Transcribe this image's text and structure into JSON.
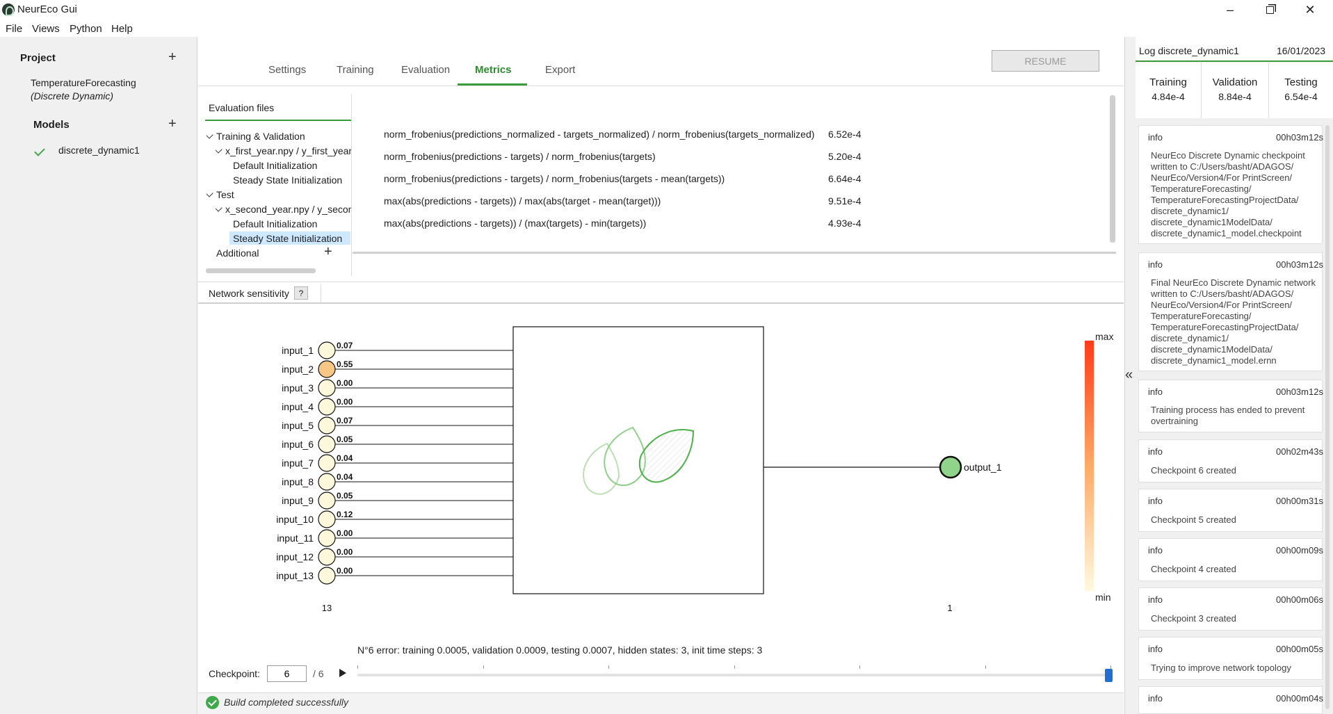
{
  "window": {
    "title": "NeurEco Gui"
  },
  "menu": [
    "File",
    "Views",
    "Python",
    "Help"
  ],
  "project": {
    "section_label": "Project",
    "name": "TemperatureForecasting",
    "type": "(Discrete Dynamic)",
    "models_label": "Models",
    "models": [
      "discrete_dynamic1"
    ]
  },
  "tabs": [
    "Settings",
    "Training",
    "Evaluation",
    "Metrics",
    "Export"
  ],
  "active_tab": "Metrics",
  "resume_label": "RESUME",
  "evaluation": {
    "header": "Evaluation files",
    "tree": {
      "group1": "Training & Validation",
      "file1": "x_first_year.npy / y_first_year.",
      "init_default1": "Default Initialization",
      "init_steady1": "Steady State Initialization",
      "group2": "Test",
      "file2": "x_second_year.npy / y_second",
      "init_default2": "Default Initialization",
      "init_steady2": "Steady State Initialization",
      "additional": "Additional"
    }
  },
  "metrics": [
    {
      "label": "norm_frobenius(predictions_normalized - targets_normalized) / norm_frobenius(targets_normalized)",
      "value": "6.52e-4"
    },
    {
      "label": "norm_frobenius(predictions - targets) / norm_frobenius(targets)",
      "value": "5.20e-4"
    },
    {
      "label": "norm_frobenius(predictions - targets) / norm_frobenius(targets - mean(targets))",
      "value": "6.64e-4"
    },
    {
      "label": "max(abs(predictions - targets)) / max(abs(target - mean(target)))",
      "value": "9.51e-4"
    },
    {
      "label": "max(abs(predictions - targets)) / (max(targets) - min(targets))",
      "value": "4.93e-4"
    }
  ],
  "sensitivity": {
    "tab_label": "Network sensitivity",
    "help_label": "?",
    "inputs": [
      {
        "name": "input_1",
        "value": "0.07"
      },
      {
        "name": "input_2",
        "value": "0.55"
      },
      {
        "name": "input_3",
        "value": "0.00"
      },
      {
        "name": "input_4",
        "value": "0.00"
      },
      {
        "name": "input_5",
        "value": "0.07"
      },
      {
        "name": "input_6",
        "value": "0.05"
      },
      {
        "name": "input_7",
        "value": "0.04"
      },
      {
        "name": "input_8",
        "value": "0.04"
      },
      {
        "name": "input_9",
        "value": "0.05"
      },
      {
        "name": "input_10",
        "value": "0.12"
      },
      {
        "name": "input_11",
        "value": "0.00"
      },
      {
        "name": "input_12",
        "value": "0.00"
      },
      {
        "name": "input_13",
        "value": "0.00"
      }
    ],
    "output": {
      "name": "output_1"
    },
    "input_count": "13",
    "output_count": "1",
    "scale_max": "max",
    "scale_min": "min",
    "colors": {
      "input_low": "#fdf7dc",
      "input_high": "#f9c785",
      "output": "#8fd48a",
      "scale_top": "#ff3b1a",
      "scale_bottom": "#fff9e0"
    }
  },
  "checkpoint": {
    "status_text": "N°6 error: training 0.0005, validation 0.0009, testing 0.0007, hidden states: 3, init time steps: 3",
    "label": "Checkpoint:",
    "current": "6",
    "total": "/ 6",
    "slider_fraction": 1.0
  },
  "build_status": "Build completed successfully",
  "log": {
    "title": "Log discrete_dynamic1",
    "date": "16/01/2023",
    "summary": [
      {
        "label": "Training",
        "value": "4.84e-4"
      },
      {
        "label": "Validation",
        "value": "8.84e-4"
      },
      {
        "label": "Testing",
        "value": "6.54e-4"
      }
    ],
    "entries": [
      {
        "type": "info",
        "time": "00h03m12s",
        "message": "NeurEco Discrete Dynamic checkpoint\nwritten to C:/Users/basht/ADAGOS/\nNeurEco/Version4/For PrintScreen/\nTemperatureForecasting/\nTemperatureForecastingProjectData/\ndiscrete_dynamic1/\ndiscrete_dynamic1ModelData/\ndiscrete_dynamic1_model.checkpoint"
      },
      {
        "type": "info",
        "time": "00h03m12s",
        "message": "Final NeurEco Discrete Dynamic network\nwritten to C:/Users/basht/ADAGOS/\nNeurEco/Version4/For PrintScreen/\nTemperatureForecasting/\nTemperatureForecastingProjectData/\ndiscrete_dynamic1/\ndiscrete_dynamic1ModelData/\ndiscrete_dynamic1_model.ernn"
      },
      {
        "type": "info",
        "time": "00h03m12s",
        "message": "Training process has ended to prevent\novertraining"
      },
      {
        "type": "info",
        "time": "00h02m43s",
        "message": "Checkpoint 6 created"
      },
      {
        "type": "info",
        "time": "00h00m31s",
        "message": "Checkpoint 5 created"
      },
      {
        "type": "info",
        "time": "00h00m09s",
        "message": "Checkpoint 4 created"
      },
      {
        "type": "info",
        "time": "00h00m06s",
        "message": "Checkpoint 3 created"
      },
      {
        "type": "info",
        "time": "00h00m05s",
        "message": "Trying to improve network topology"
      },
      {
        "type": "info",
        "time": "00h00m04s",
        "message": ""
      }
    ]
  }
}
